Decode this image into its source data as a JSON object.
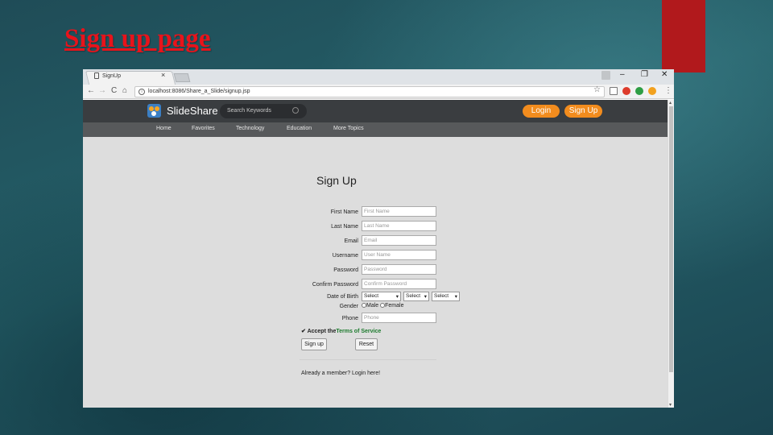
{
  "slide": {
    "title": "Sign up page"
  },
  "browser": {
    "tab_title": "SignUp",
    "tab_close": "×",
    "window_controls": {
      "minimize": "–",
      "restore": "❐",
      "close": "✕"
    },
    "nav_icons": {
      "back": "←",
      "forward": "→",
      "reload": "C",
      "home": "⌂"
    },
    "url": "localhost:8086/Share_a_Slide/signup.jsp",
    "bookmark_icon": "☆",
    "extension_colors": [
      "#dd3b2b",
      "#2e9e44",
      "#f2a11e"
    ]
  },
  "site": {
    "logo_text": "SlideShare",
    "search_placeholder": "Search Keywords",
    "login_label": "Login",
    "signup_label": "Sign Up",
    "nav": [
      "Home",
      "Favorites",
      "Technology",
      "Education",
      "More Topics"
    ],
    "brand_color": "#f28c1e"
  },
  "form": {
    "heading": "Sign Up",
    "fields": [
      {
        "label": "First Name",
        "placeholder": "First Name"
      },
      {
        "label": "Last Name",
        "placeholder": "Last Name"
      },
      {
        "label": "Email",
        "placeholder": "Email"
      },
      {
        "label": "Username",
        "placeholder": "User Name"
      },
      {
        "label": "Password",
        "placeholder": "Password"
      },
      {
        "label": "Confirm Password",
        "placeholder": "Confirm Password"
      }
    ],
    "dob_label": "Date of Birth",
    "dob_selects": [
      "Select",
      "Select",
      "Select"
    ],
    "gender_label": "Gender",
    "gender_options": [
      "Male",
      "Female"
    ],
    "phone_label": "Phone",
    "phone_placeholder": "Phone",
    "terms_prefix": "Accept the",
    "terms_link": "Terms of Service",
    "signup_button": "Sign up",
    "reset_button": "Reset",
    "member_text": "Already a member? Login here!"
  }
}
